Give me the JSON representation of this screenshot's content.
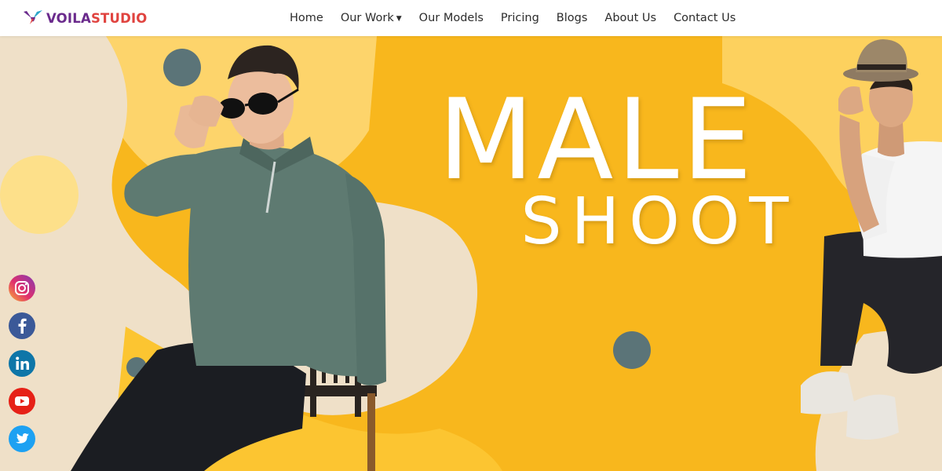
{
  "brand": {
    "name_part1": "VOILA",
    "name_part2": "STUDIO"
  },
  "nav": {
    "items": [
      {
        "label": "Home"
      },
      {
        "label": "Our Work",
        "has_dropdown": true
      },
      {
        "label": "Our Models"
      },
      {
        "label": "Pricing"
      },
      {
        "label": "Blogs"
      },
      {
        "label": "About Us"
      },
      {
        "label": "Contact Us"
      }
    ]
  },
  "hero": {
    "headline_line1": "MALE",
    "headline_line2": "SHOOT"
  },
  "social": [
    "instagram-icon",
    "facebook-icon",
    "linkedin-icon",
    "youtube-icon",
    "twitter-icon"
  ],
  "colors": {
    "hero_yellow": "#f8b71d",
    "cream": "#efe0c8",
    "slate_dot": "#5b7478",
    "brand_purple": "#6a2a8c",
    "brand_red": "#e0433f"
  }
}
